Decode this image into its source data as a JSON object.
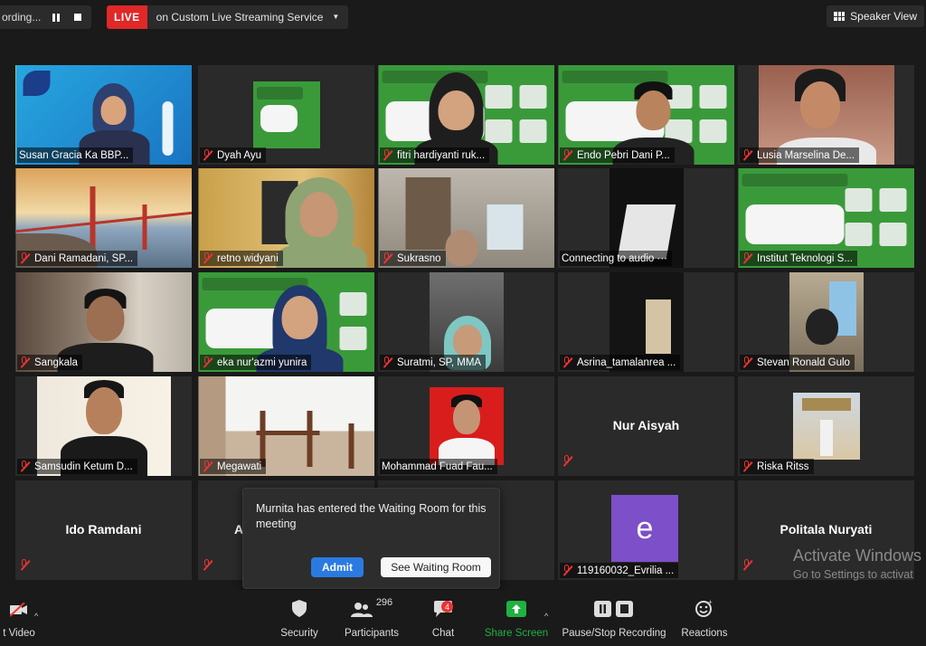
{
  "topbar": {
    "recording_label": "ording...",
    "live_badge": "LIVE",
    "live_service": "on Custom Live Streaming Service",
    "view_button": "Speaker View"
  },
  "tiles": [
    {
      "name": "Susan Gracia Ka BBP..."
    },
    {
      "name": "Dyah Ayu"
    },
    {
      "name": "fitri hardiyanti ruk..."
    },
    {
      "name": "Endo Pebri Dani P..."
    },
    {
      "name": "Lusia Marselina De..."
    },
    {
      "name": "Dani Ramadani, SP..."
    },
    {
      "name": "retno widyani"
    },
    {
      "name": "Sukrasno"
    },
    {
      "name": "Connecting to audio ···"
    },
    {
      "name": "Institut Teknologi S..."
    },
    {
      "name": "Sangkala"
    },
    {
      "name": "eka nur'azmi yunira"
    },
    {
      "name": "Suratmi, SP, MMA"
    },
    {
      "name": "Asrina_tamalanrea ..."
    },
    {
      "name": "Stevan Ronald Gulo"
    },
    {
      "name": "Samsudin Ketum D..."
    },
    {
      "name": "Megawati"
    },
    {
      "name": "Mohammad Fuad Fau..."
    },
    {
      "name": "Nur Aisyah"
    },
    {
      "name": "Riska Ritss"
    },
    {
      "name": "Ido Ramdani"
    },
    {
      "name": "A"
    },
    {
      "name": ""
    },
    {
      "name": "119160032_Evrilia ..."
    },
    {
      "name": "Politala Nuryati"
    }
  ],
  "avatar_letter": "e",
  "notification": {
    "message": "Murnita has entered the Waiting Room for this meeting",
    "admit": "Admit",
    "see_waiting_room": "See Waiting Room"
  },
  "watermark": {
    "line1": "Activate Windows",
    "line2": "Go to Settings to activat"
  },
  "toolbar": {
    "video": "t Video",
    "security": "Security",
    "participants": "Participants",
    "participants_count": "296",
    "chat": "Chat",
    "chat_badge": "4",
    "share_screen": "Share Screen",
    "recording": "Pause/Stop Recording",
    "reactions": "Reactions"
  },
  "colors": {
    "live": "#e02828",
    "active_speaker": "#f2e24b",
    "admit_button": "#2a7ae2",
    "share_screen": "#1fb141",
    "avatar": "#7d4fc9"
  }
}
